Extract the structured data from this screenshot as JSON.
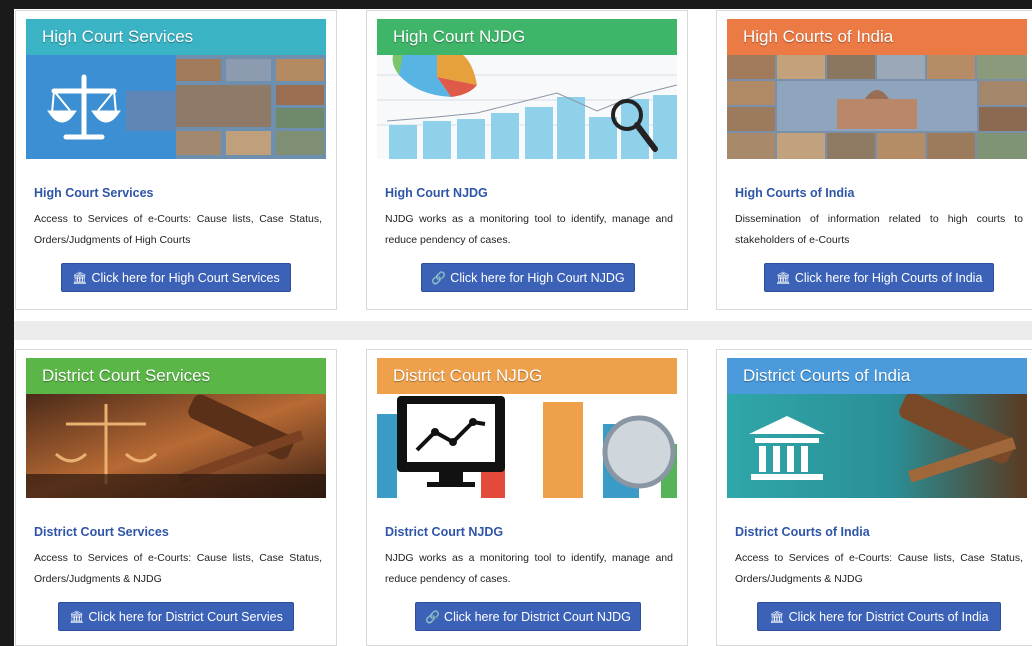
{
  "cards": [
    {
      "header": "High Court Services",
      "header_color": "#3ab3c4",
      "title": "High Court Services",
      "description": "Access to Services of e-Courts: Cause lists, Case Status, Orders/Judgments of High Courts",
      "button_label": "Click here for High Court Services",
      "button_icon": "bank-icon",
      "button_glyph": "🏛"
    },
    {
      "header": "High Court NJDG",
      "header_color": "#3fb56a",
      "title": "High Court NJDG",
      "description": "NJDG works as a monitoring tool to identify, manage and reduce pendency of cases.",
      "button_label": "Click here for High Court NJDG",
      "button_icon": "link-icon",
      "button_glyph": "🔗"
    },
    {
      "header": "High Courts of India",
      "header_color": "#ec7a45",
      "title": "High Courts of India",
      "description": "Dissemination of information related to high courts to stakeholders of e-Courts",
      "button_label": "Click here for High Courts of India",
      "button_icon": "bank-icon",
      "button_glyph": "🏛"
    },
    {
      "header": "District Court Services",
      "header_color": "#5bb648",
      "title": "District Court Services",
      "description": "Access to Services of e-Courts: Cause lists, Case Status, Orders/Judgments & NJDG",
      "button_label": "Click here for District Court Servies",
      "button_icon": "bank-icon",
      "button_glyph": "🏛"
    },
    {
      "header": "District Court NJDG",
      "header_color": "#efa04b",
      "title": "District Court NJDG",
      "description": "NJDG works as a monitoring tool to identify, manage and reduce pendency of cases.",
      "button_label": "Click here for District Court NJDG",
      "button_icon": "link-icon",
      "button_glyph": "🔗"
    },
    {
      "header": "District Courts of India",
      "header_color": "#4b9bdc",
      "title": "District Courts of India",
      "description": "Access to Services of e-Courts: Cause lists, Case Status, Orders/Judgments & NJDG",
      "button_label": "Click here for District Courts of India",
      "button_icon": "bank-icon",
      "button_glyph": "🏛"
    }
  ]
}
